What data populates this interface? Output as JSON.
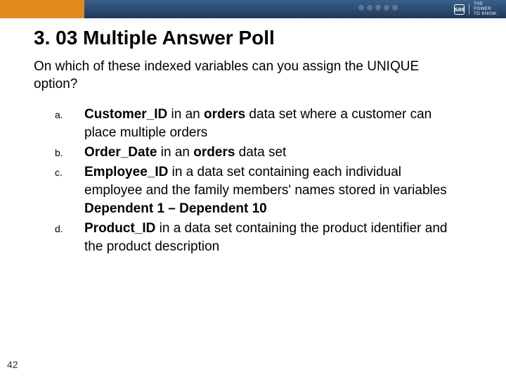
{
  "brand": {
    "logo_text": "sas",
    "tagline_line1": "THE",
    "tagline_line2": "POWER",
    "tagline_line3": "TO KNOW."
  },
  "title": "3. 03 Multiple Answer Poll",
  "question": "On which of these indexed variables can you assign the UNIQUE option?",
  "answers": {
    "a": {
      "letter": "a."
    },
    "b": {
      "letter": "b."
    },
    "c": {
      "letter": "c."
    },
    "d": {
      "letter": "d."
    }
  },
  "page_number": "42"
}
